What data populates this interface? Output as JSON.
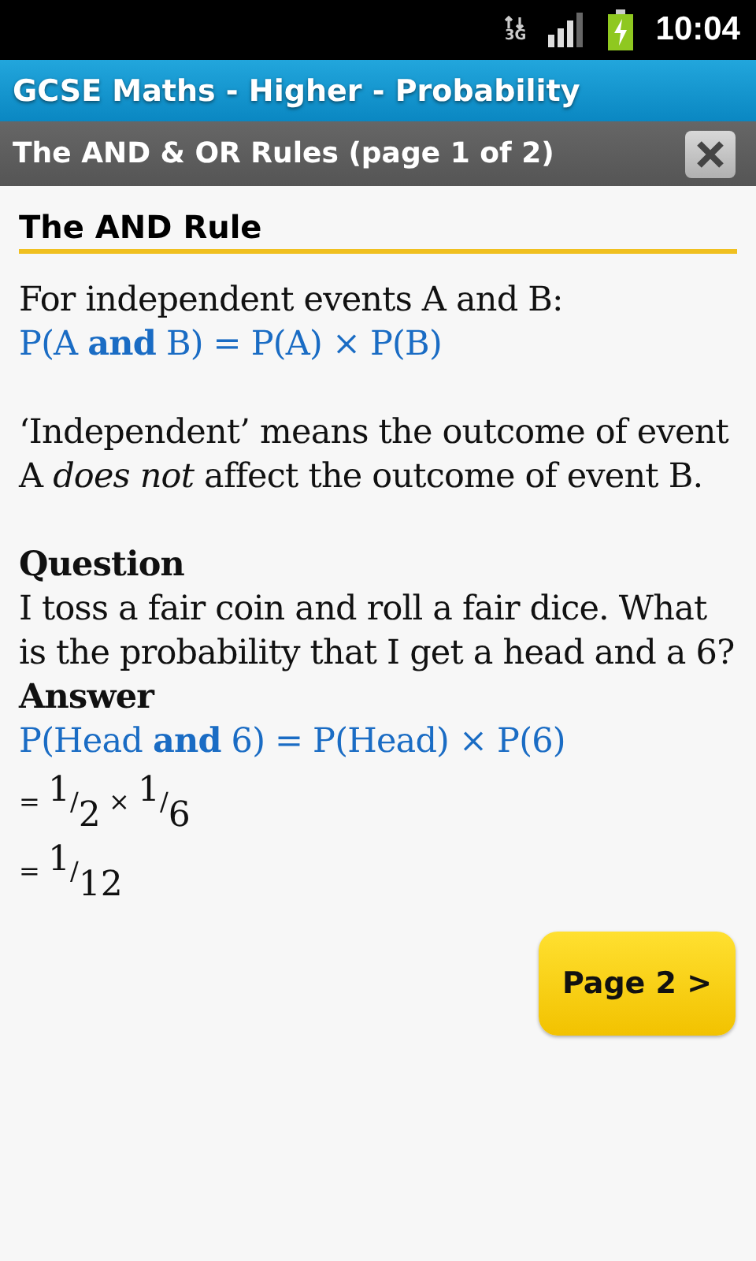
{
  "status_bar": {
    "network": "3G",
    "time": "10:04"
  },
  "app_title": "GCSE Maths - Higher - Probability",
  "page_header": {
    "title": "The AND & OR Rules (page 1 of 2)"
  },
  "section_heading": "The AND Rule",
  "content": [
    {
      "kind": "text",
      "text": "For independent events A and B:"
    },
    {
      "kind": "formula",
      "text": "P(A **and** B) = P(A) × P(B)"
    },
    {
      "kind": "gap"
    },
    {
      "kind": "text",
      "text": "‘Independent’ means the outcome of event A *does not* affect the outcome of event B."
    },
    {
      "kind": "gap"
    },
    {
      "kind": "label",
      "text": "Question"
    },
    {
      "kind": "text",
      "text": "I toss a fair coin and roll a fair dice. What is the probability that I get a head and a 6?"
    },
    {
      "kind": "label",
      "text": "Answer"
    },
    {
      "kind": "formula",
      "text": "P(Head **and** 6) = P(Head) × P(6)"
    },
    {
      "kind": "fraction_line",
      "text": "= $^{1}$/$_{2}$ × $^{1}$/$_{6}$"
    },
    {
      "kind": "fraction_line",
      "text": "= $^{1}$/$_{12}$"
    }
  ],
  "next_button": "Page 2 >"
}
